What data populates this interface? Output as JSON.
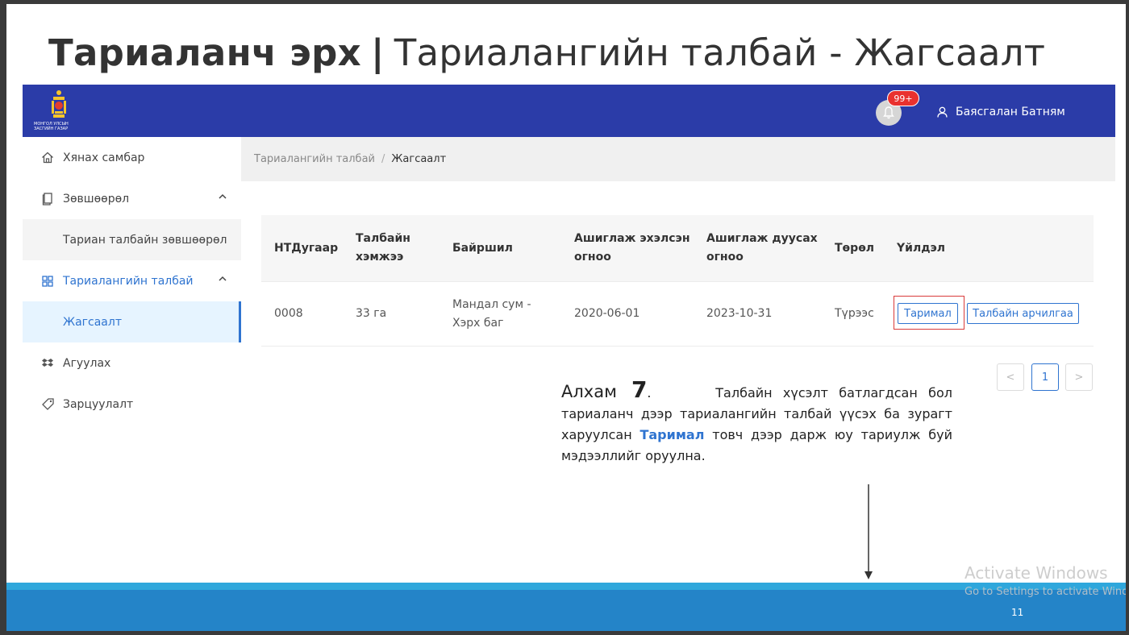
{
  "slide": {
    "title_bold": "Тариаланч эрх",
    "title_sep": "|",
    "title_rest": "Тариалангийн талбай - Жагсаалт",
    "page_number": "11"
  },
  "app": {
    "logo_text": "МОНГОЛ УЛСЫН\nЗАСГИЙН ГАЗАР",
    "notifications": {
      "badge": "99+"
    },
    "user_name": "Баясгалан Батням",
    "sidebar": {
      "items": [
        {
          "label": "Хянах самбар",
          "icon": "home-icon"
        },
        {
          "label": "Зөвшөөрөл",
          "icon": "document-icon"
        },
        {
          "label": "Тариан талбайн зөвшөөрөл"
        },
        {
          "label": "Тариалангийн талбай",
          "icon": "grid-icon"
        },
        {
          "label": "Жагсаалт"
        },
        {
          "label": "Агуулах",
          "icon": "dropbox-icon"
        },
        {
          "label": "Зарцуулалт",
          "icon": "tag-icon"
        }
      ]
    },
    "breadcrumb": {
      "parent": "Тариалангийн талбай",
      "sep": "/",
      "current": "Жагсаалт"
    },
    "table": {
      "headers": [
        "НТДугаар",
        "Талбайн хэмжээ",
        "Байршил",
        "Ашиглаж эхэлсэн огноо",
        "Ашиглаж дуусах огноо",
        "Төрөл",
        "Үйлдэл"
      ],
      "rows": [
        {
          "id": "0008",
          "size": "33 га",
          "location": "Мандал сум - Хэрх баг",
          "start": "2020-06-01",
          "end": "2023-10-31",
          "type": "Түрээс"
        }
      ],
      "actions": {
        "crop": "Таримал",
        "history": "Талбайн арчилгаа"
      }
    },
    "pagination": {
      "prev": "<",
      "current": "1",
      "next": ">"
    }
  },
  "note": {
    "step_word": "Алхам",
    "step_num": "7",
    "step_dot": ".",
    "text_before": "Талбайн хүсэлт батлагдсан бол тариаланч дээр тариалангийн талбай үүсэх ба зурагт харуулсан",
    "highlight": "Таримал",
    "text_after": "товч дээр дарж юу тариулж буй мэдээллийг оруулна."
  },
  "watermark": {
    "line1": "Activate Windows",
    "line2": "Go to Settings to activate Windows."
  },
  "colors": {
    "topbar": "#2b3ca8",
    "accent": "#2f74d0",
    "badge": "#e9312f",
    "footer": "#2484c8",
    "footer_line": "#2fa7dc"
  }
}
